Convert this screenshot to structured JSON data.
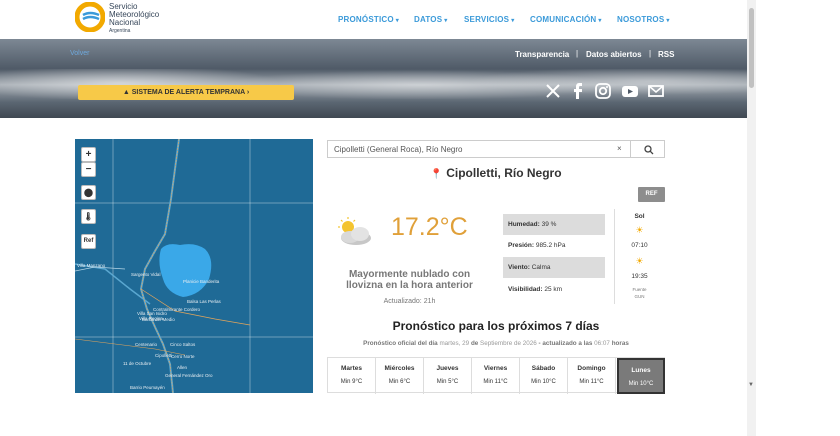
{
  "logo": {
    "line1": "Servicio",
    "line2": "Meteorológico",
    "line3": "Nacional",
    "line4": "Argentina"
  },
  "nav": [
    {
      "label": "PRONÓSTICO"
    },
    {
      "label": "DATOS"
    },
    {
      "label": "SERVICIOS"
    },
    {
      "label": "COMUNICACIÓN"
    },
    {
      "label": "NOSOTROS"
    }
  ],
  "banner": {
    "back_label": "Volver",
    "links": [
      "Transparencia",
      "Datos abiertos",
      "RSS"
    ],
    "alert_label": "SISTEMA DE ALERTA TEMPRANA",
    "social_icons": [
      "x-icon",
      "facebook-icon",
      "instagram-icon",
      "youtube-icon",
      "email-icon"
    ]
  },
  "map": {
    "zoom_in": "+",
    "zoom_out": "−",
    "ref_label": "Ref",
    "labels": [
      "Villa Manzano",
      "Sargento Vidal",
      "Villa San Isidro",
      "Barda del Medio",
      "Planicie Banderita",
      "Balsa Las Perlas",
      "Cinco Saltos",
      "Contralmirante Cordero",
      "Villa Regina",
      "Cipolletti",
      "11 de Octubre",
      "General Fernández Oro",
      "Allen",
      "Cerro Norte",
      "Centenario",
      "Barrio Peumayén"
    ]
  },
  "search": {
    "value": "Cipolletti (General Roca), Río Negro",
    "clear": "×"
  },
  "location": {
    "name": "Cipolletti, Río Negro"
  },
  "ref_button": "REF",
  "current": {
    "temperature": "17.2°C",
    "condition": "Mayormente nublado con llovizna en la hora anterior",
    "updated": "Actualizado: 21h",
    "humidity_label": "Humedad:",
    "humidity": "39 %",
    "pressure_label": "Presión:",
    "pressure": "985.2 hPa",
    "wind_label": "Viento:",
    "wind": "Calma",
    "visibility_label": "Visibilidad:",
    "visibility": "25 km",
    "sun_label": "Sol",
    "sunrise": "07:10",
    "sunset": "19:35",
    "source": "Fuente",
    "source_value": "GUN"
  },
  "forecast": {
    "title": "Pronóstico para los próximos 7 días",
    "subtitle_prefix": "Pronóstico oficial del día",
    "subtitle_date": "martes, 29",
    "subtitle_de": "de",
    "subtitle_month": "Septiembre de 2026",
    "subtitle_mid": "- actualizado a las",
    "subtitle_time": "06:07",
    "subtitle_suffix": "horas",
    "days": [
      {
        "name": "Martes",
        "min": "Min 9°C"
      },
      {
        "name": "Miércoles",
        "min": "Min 6°C"
      },
      {
        "name": "Jueves",
        "min": "Min 5°C"
      },
      {
        "name": "Viernes",
        "min": "Min 11°C"
      },
      {
        "name": "Sábado",
        "min": "Min 10°C"
      },
      {
        "name": "Domingo",
        "min": "Min 11°C"
      },
      {
        "name": "Lunes",
        "min": "Min 10°C"
      }
    ]
  },
  "colors": {
    "accent": "#3b9ad9",
    "alert": "#f7c948",
    "temperature": "#e0a039",
    "map_water": "#1f6a96"
  }
}
